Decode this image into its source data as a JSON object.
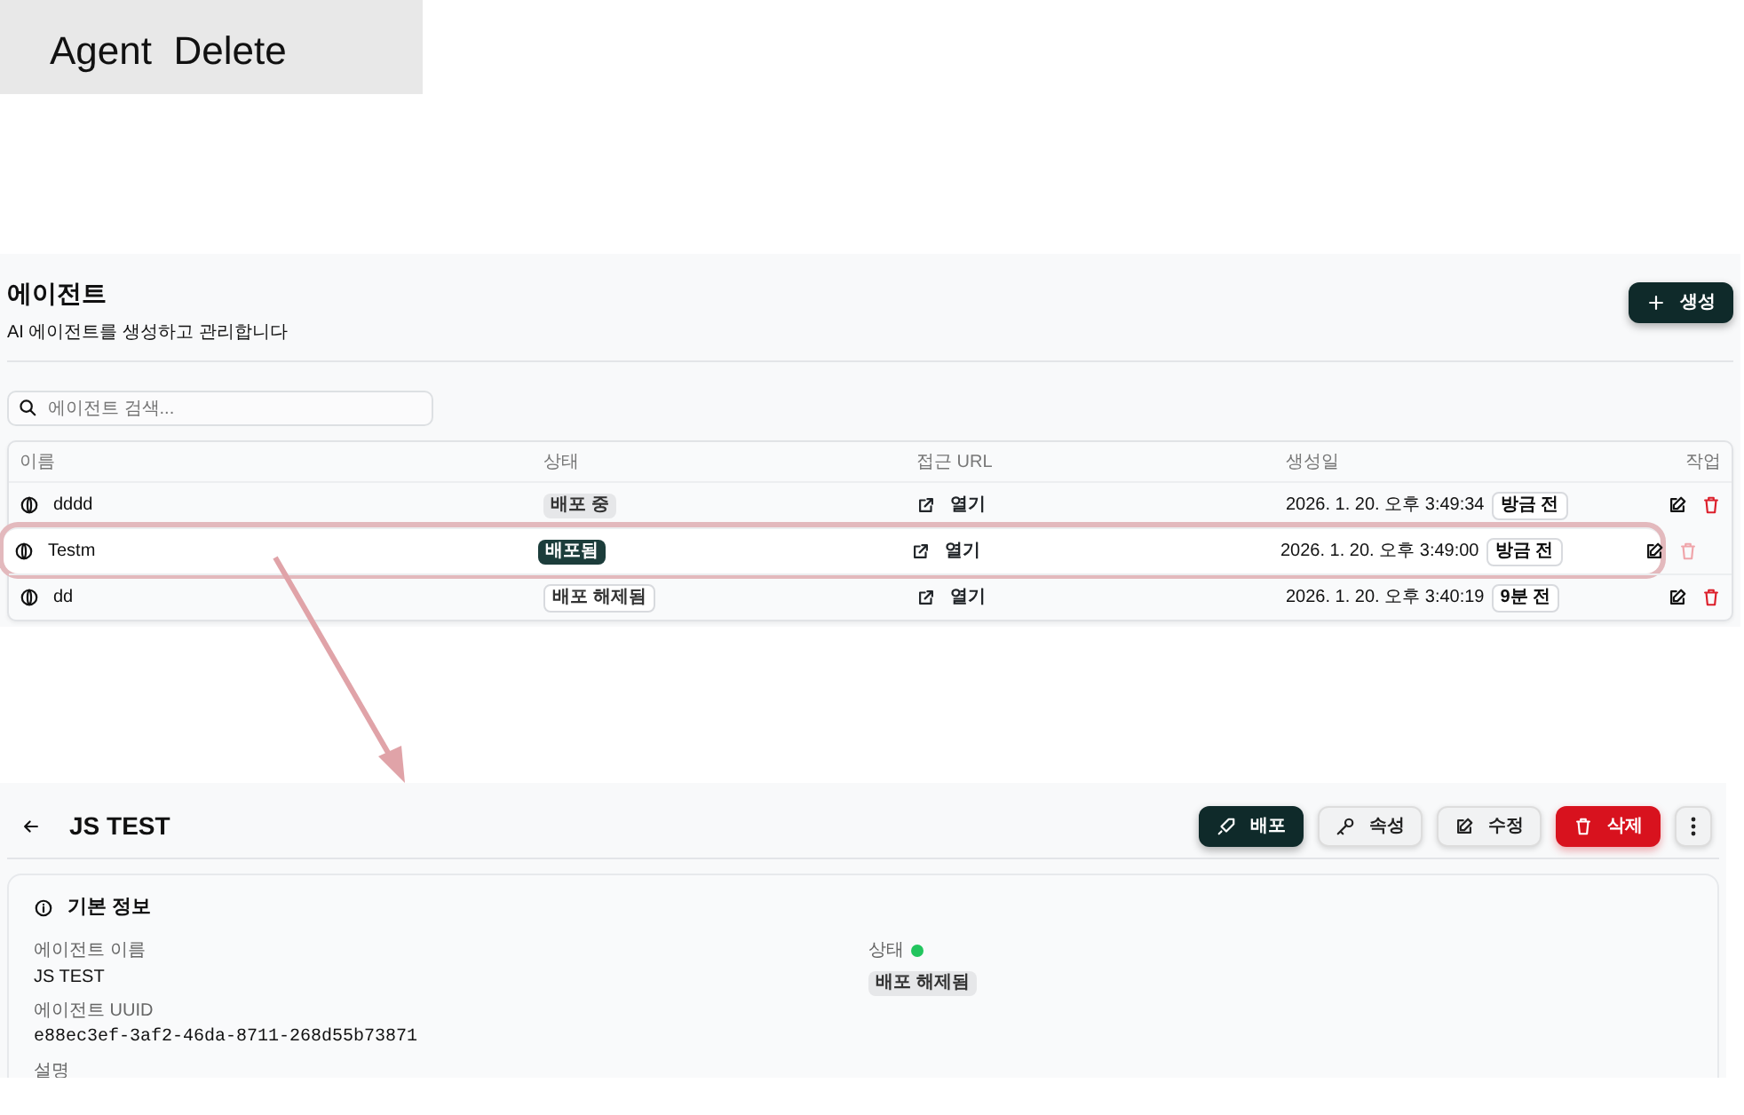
{
  "caption": "Agent  Delete",
  "list_page": {
    "title": "에이전트",
    "subtitle": "AI 에이전트를 생성하고 관리합니다",
    "create_button": "생성",
    "search": {
      "placeholder": "에이전트 검색..."
    },
    "table": {
      "columns": [
        "이름",
        "상태",
        "접근 URL",
        "생성일",
        "작업"
      ],
      "rows": [
        {
          "name": "dddd",
          "status": {
            "label": "배포 중",
            "kind": "deploying"
          },
          "url": "열기",
          "created": "2026. 1. 20. 오후 3:49:34",
          "ago": "방금 전",
          "highlighted": false,
          "delete_disabled": false
        },
        {
          "name": "Testm",
          "status": {
            "label": "배포됨",
            "kind": "deployed"
          },
          "url": "열기",
          "created": "2026. 1. 20. 오후 3:49:00",
          "ago": "방금 전",
          "highlighted": true,
          "delete_disabled": true
        },
        {
          "name": "dd",
          "status": {
            "label": "배포 해제됨",
            "kind": "undeployed"
          },
          "url": "열기",
          "created": "2026. 1. 20. 오후 3:40:19",
          "ago": "9분 전",
          "highlighted": false,
          "delete_disabled": false
        }
      ]
    }
  },
  "detail_page": {
    "title": "JS TEST",
    "buttons": [
      {
        "label": "배포",
        "kind": "deploy"
      },
      {
        "label": "속성",
        "kind": "properties"
      },
      {
        "label": "수정",
        "kind": "edit"
      },
      {
        "label": "삭제",
        "kind": "delete"
      },
      {
        "kind": "more"
      }
    ],
    "card": {
      "title": "기본 정보",
      "left_fields": [
        {
          "label": "에이전트 이름",
          "value": "JS TEST",
          "kind": "text"
        },
        {
          "label": "에이전트 UUID",
          "value": "e88ec3ef-3af2-46da-8711-268d55b73871",
          "kind": "mono"
        },
        {
          "label": "설명"
        }
      ],
      "status": {
        "label": "상태",
        "color": "#22c55e",
        "badge": "배포 해제됨"
      }
    }
  }
}
